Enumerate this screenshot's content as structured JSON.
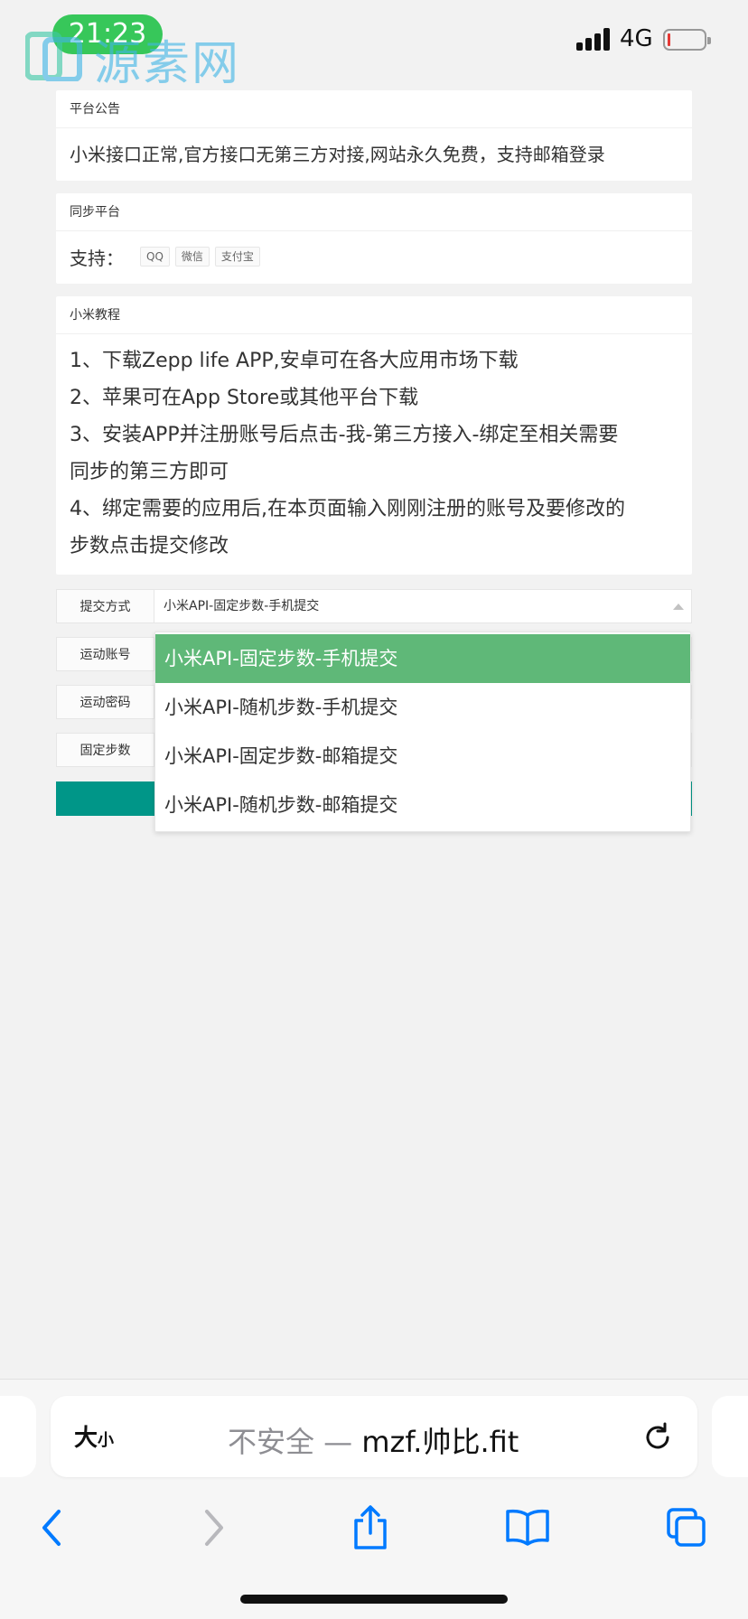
{
  "status_bar": {
    "time": "21:23",
    "network": "4G"
  },
  "watermark": {
    "text": "源素网"
  },
  "notice": {
    "header": "平台公告",
    "text": "小米接口正常,官方接口无第三方对接,网站永久免费，支持邮箱登录"
  },
  "sync": {
    "header": "同步平台",
    "support_label": "支持：",
    "tags": [
      "QQ",
      "微信",
      "支付宝"
    ]
  },
  "tutorial": {
    "header": "小米教程",
    "lines": [
      "1、下载Zepp life APP,安卓可在各大应用市场下载",
      "2、苹果可在App Store或其他平台下载",
      "3、安装APP并注册账号后点击-我-第三方接入-绑定至相关需要",
      "同步的第三方即可",
      "4、绑定需要的应用后,在本页面输入刚刚注册的账号及要修改的",
      "步数点击提交修改"
    ]
  },
  "form": {
    "submit_method_label": "提交方式",
    "submit_method_value": "小米API-固定步数-手机提交",
    "account_label": "运动账号",
    "password_label": "运动密码",
    "steps_label": "固定步数",
    "submit_label": ""
  },
  "dropdown": {
    "options": [
      "小米API-固定步数-手机提交",
      "小米API-随机步数-手机提交",
      "小米API-固定步数-邮箱提交",
      "小米API-随机步数-邮箱提交"
    ],
    "selected_index": 0
  },
  "browser": {
    "text_size_big": "大",
    "text_size_small": "小",
    "insecure_label": "不安全 — ",
    "domain": "mzf.帅比.fit"
  },
  "colors": {
    "accent_green": "#5fb878",
    "button_teal": "#009688",
    "time_pill": "#37c75a",
    "ios_blue": "#007aff",
    "watermark": "#41b6e6"
  },
  "icons": [
    "signal-icon",
    "battery-icon",
    "reload-icon",
    "back-icon",
    "forward-icon",
    "share-icon",
    "bookmarks-icon",
    "tabs-icon"
  ]
}
